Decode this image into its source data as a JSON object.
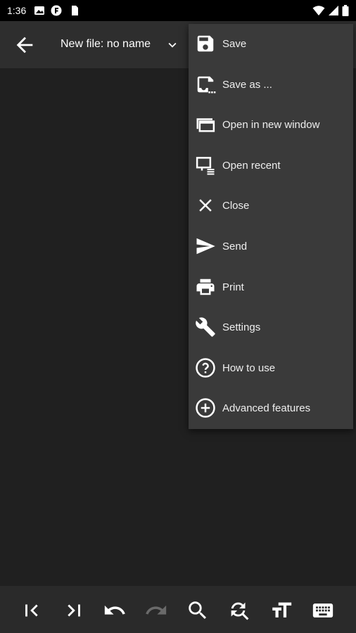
{
  "status_bar": {
    "time": "1:36",
    "icons": [
      "image-icon",
      "f-app-icon",
      "sim-card-icon",
      "wifi-icon",
      "signal-icon",
      "battery-icon"
    ]
  },
  "app_bar": {
    "title": "New file: no name",
    "back_icon": "arrow-back-icon",
    "dropdown_icon": "chevron-down-icon"
  },
  "menu": {
    "items": [
      {
        "label": "Save",
        "icon": "save-icon"
      },
      {
        "label": "Save as ...",
        "icon": "save-as-icon"
      },
      {
        "label": "Open in new window",
        "icon": "open-window-icon"
      },
      {
        "label": "Open recent",
        "icon": "open-recent-icon"
      },
      {
        "label": "Close",
        "icon": "close-icon"
      },
      {
        "label": "Send",
        "icon": "send-icon"
      },
      {
        "label": "Print",
        "icon": "print-icon"
      },
      {
        "label": "Settings",
        "icon": "wrench-icon"
      },
      {
        "label": "How to use",
        "icon": "help-icon"
      },
      {
        "label": "Advanced features",
        "icon": "add-circle-icon"
      }
    ]
  },
  "toolbar": {
    "buttons": [
      {
        "icon": "jump-to-start-icon",
        "enabled": true
      },
      {
        "icon": "jump-to-end-icon",
        "enabled": true
      },
      {
        "icon": "undo-icon",
        "enabled": true
      },
      {
        "icon": "redo-icon",
        "enabled": false
      },
      {
        "icon": "search-icon",
        "enabled": true
      },
      {
        "icon": "search-replace-icon",
        "enabled": true
      },
      {
        "icon": "text-size-icon",
        "enabled": true
      },
      {
        "icon": "keyboard-icon",
        "enabled": true
      }
    ]
  },
  "colors": {
    "background": "#202020",
    "app_bar": "#2e2e2e",
    "menu": "#3a3a3a",
    "bottom_bar": "#2a2a2a",
    "icon": "#ffffff",
    "disabled_icon": "#6a6a6a"
  }
}
